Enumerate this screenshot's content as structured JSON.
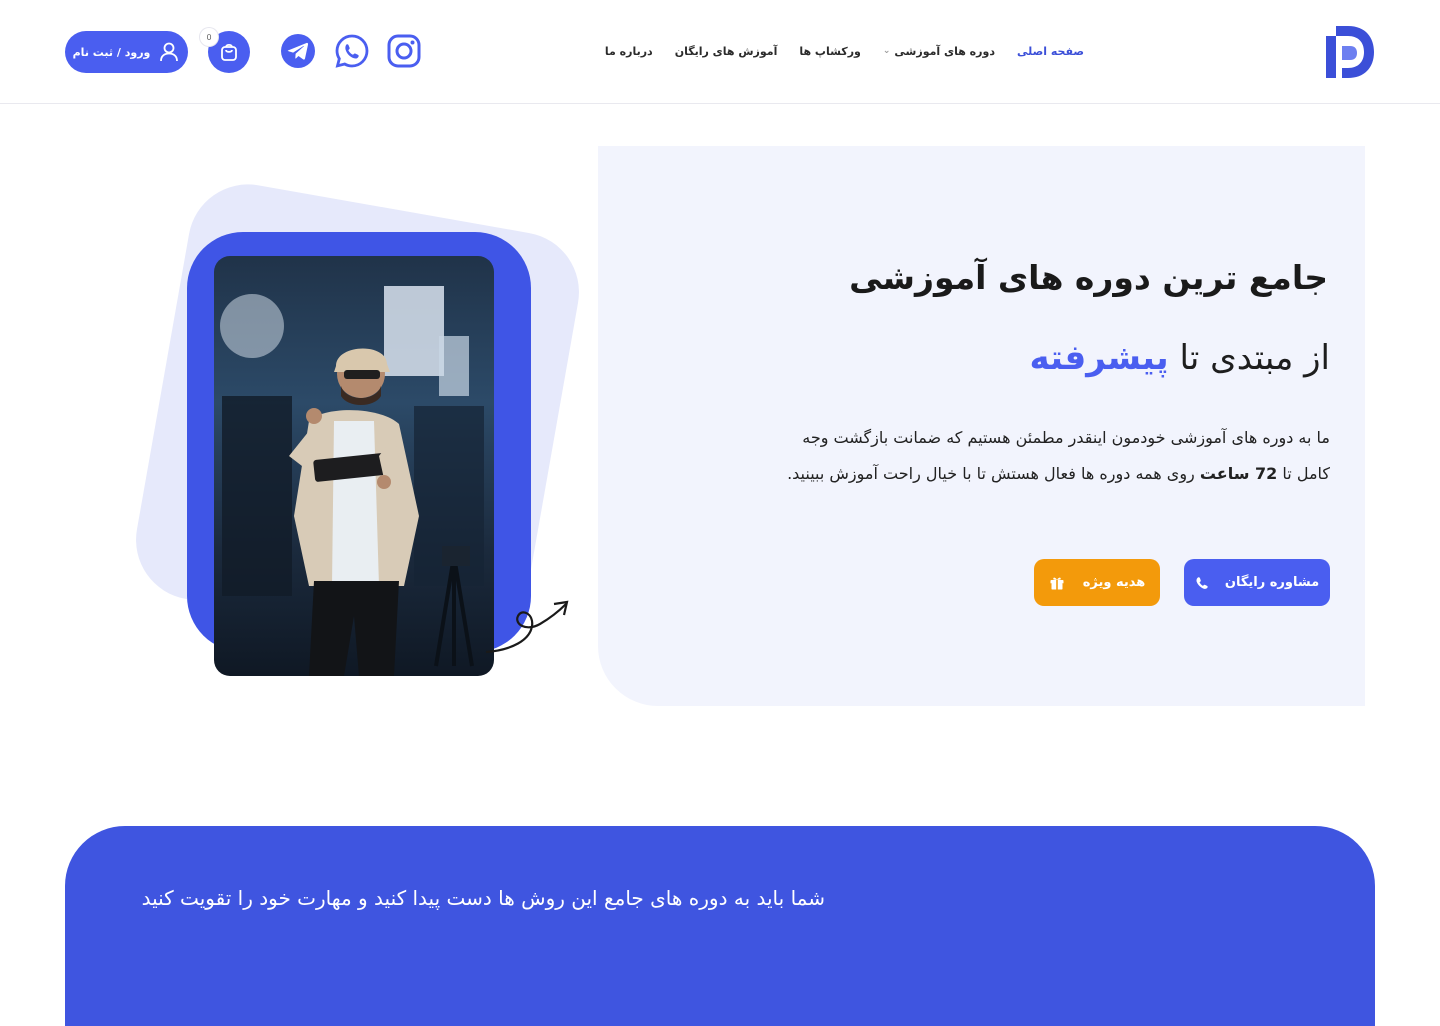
{
  "brand": {
    "logo_color": "#3b4fd8",
    "accent": "#4a5ef0",
    "orange": "#f39a0b"
  },
  "nav": {
    "items": [
      {
        "label": "صفحه اصلی",
        "active": true
      },
      {
        "label": "دوره های آموزشی",
        "has_dropdown": true
      },
      {
        "label": "ورکشاپ ها"
      },
      {
        "label": "آموزش های رایگان"
      },
      {
        "label": "درباره ما"
      }
    ]
  },
  "header": {
    "socials": [
      "instagram-icon",
      "whatsapp-icon",
      "telegram-icon"
    ],
    "cart_count": "0",
    "login_label": "ورود / ثبت نام"
  },
  "hero": {
    "title": "جامع ترین دوره های آموزشی",
    "sub_prefix": "از مبتدی تا",
    "sub_accent": "پیشرفته",
    "desc_line1": "ما به دوره های آموزشی خودمون اینقدر مطمئن هستیم که ضمانت بازگشت وجه",
    "desc_line2_a": "کامل تا",
    "desc_line2_bold": "72 ساعت",
    "desc_line2_b": "روی همه دوره ها فعال هستش تا با خیال راحت آموزش ببینید.",
    "btn_consult": "مشاوره رایگان",
    "btn_gift": "هدیه ویژه"
  },
  "banner": {
    "text": "شما باید به دوره های جامع این روش ها دست پیدا کنید و مهارت خود را تقویت کنید"
  }
}
